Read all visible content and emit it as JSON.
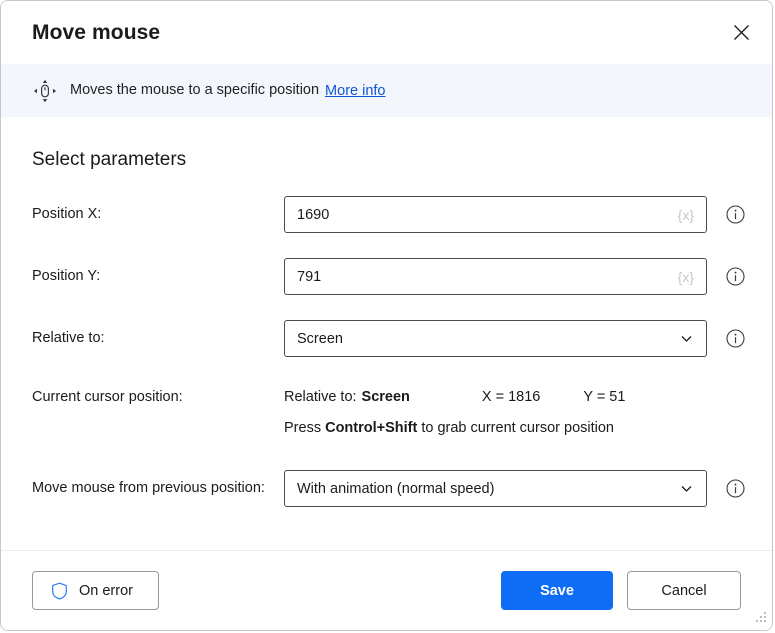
{
  "window": {
    "title": "Move mouse",
    "close_label": "✕",
    "close_icon": "close-icon"
  },
  "banner": {
    "icon": "move-mouse-icon",
    "text": "Moves the mouse to a specific position",
    "link_label": "More info"
  },
  "main": {
    "section_title": "Select parameters",
    "fields": [
      {
        "label": "Position X:",
        "value": "1690",
        "variable_glyph": "{x}",
        "info_icon": "info-icon"
      },
      {
        "label": "Position Y:",
        "value": "791",
        "variable_glyph": "{x}",
        "info_icon": "info-icon"
      },
      {
        "label": "Relative to:",
        "value": "Screen",
        "chevron_icon": "chevron-down-icon",
        "info_icon": "info-icon"
      }
    ],
    "cursor_position": {
      "label": "Current cursor position:",
      "relative_to_label": "Relative to:",
      "relative_to_value": "Screen",
      "x_readout": "X = 1816",
      "y_readout": "Y = 51",
      "hint_prefix": "Press ",
      "hint_keys": "Control+Shift",
      "hint_suffix": " to grab current cursor position"
    },
    "move_mode": {
      "label": "Move mouse from previous position:",
      "value": "With animation (normal speed)",
      "chevron_icon": "chevron-down-icon",
      "info_icon": "info-icon"
    }
  },
  "footer": {
    "on_error_label": "On error",
    "on_error_icon": "shield-icon",
    "save_label": "Save",
    "cancel_label": "Cancel",
    "resize_grip_icon": "resize-grip-icon"
  },
  "colors": {
    "accent": "#0f6cf5",
    "link": "#0f56d3",
    "banner_bg": "#f3f7fd",
    "shield": "#2b7cf5",
    "border": "#4a4a4a"
  }
}
